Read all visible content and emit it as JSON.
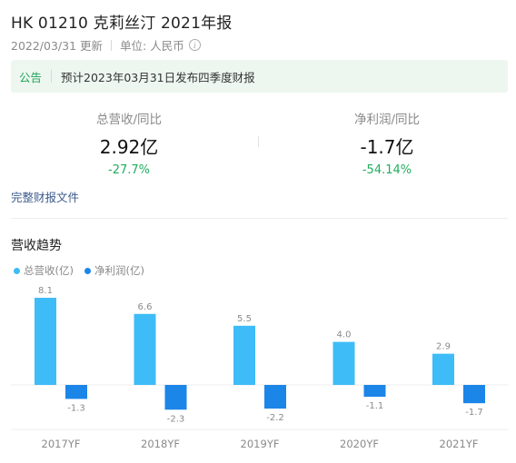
{
  "header": {
    "title": "HK 01210 克莉丝汀  2021年报",
    "date": "2022/03/31 更新",
    "unit": "单位: 人民币"
  },
  "notice": {
    "tag": "公告",
    "text": "预计2023年03月31日发布四季度财报"
  },
  "kpis": {
    "revenue": {
      "label": "总营收/同比",
      "value": "2.92亿",
      "change": "-27.7%"
    },
    "profit": {
      "label": "净利润/同比",
      "value": "-1.7亿",
      "change": "-54.14%"
    }
  },
  "links": {
    "full_report": "完整财报文件"
  },
  "section": {
    "title": "营收趋势"
  },
  "colors": {
    "revenue": "#3ebcf7",
    "profit": "#1c85e8",
    "positive_change": "#1fae5d",
    "notice_tag": "#21a55b"
  },
  "chart_data": {
    "type": "bar",
    "categories": [
      "2017YF",
      "2018YF",
      "2019YF",
      "2020YF",
      "2021YF"
    ],
    "series": [
      {
        "name": "总营收(亿)",
        "values": [
          8.1,
          6.6,
          5.5,
          4.0,
          2.9
        ]
      },
      {
        "name": "净利润(亿)",
        "values": [
          -1.3,
          -2.3,
          -2.2,
          -1.1,
          -1.7
        ]
      }
    ]
  }
}
